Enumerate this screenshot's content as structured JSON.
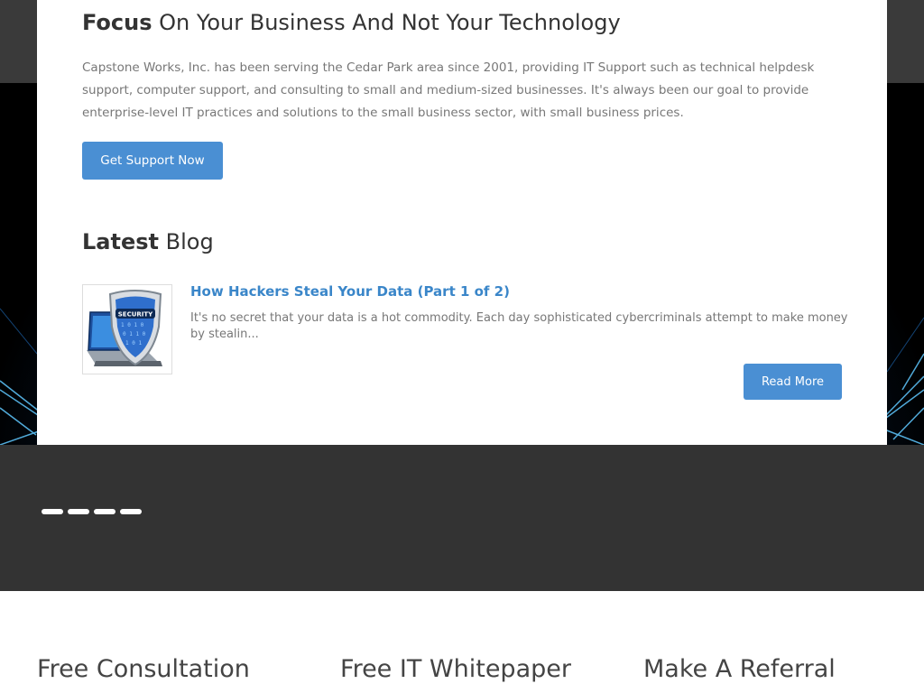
{
  "focus": {
    "title_bold": "Focus",
    "title_rest": "On Your Business And Not Your Technology",
    "intro": "Capstone Works, Inc. has been serving the Cedar Park area since 2001, providing IT Support such as technical helpdesk support, computer support, and consulting to small and medium-sized businesses. It's always been our goal to provide enterprise-level IT practices and solutions to the small business sector, with small business prices.",
    "button_label": "Get Support Now"
  },
  "latest": {
    "title_bold": "Latest",
    "title_rest": "Blog",
    "post": {
      "title": "How Hackers Steal Your Data (Part 1 of 2)",
      "excerpt": "It's no secret that your data is a hot commodity. Each day sophisticated cybercriminals attempt to make money by stealin...",
      "read_more_label": "Read More",
      "thumbnail_icon": "security-shield-laptop-icon",
      "thumbnail_text": "SECURITY"
    }
  },
  "slider": {
    "dot_count": 4
  },
  "bottom": {
    "headings": [
      "Free Consultation",
      "Free IT Whitepaper",
      "Make A Referral"
    ]
  },
  "colors": {
    "accent": "#4a8fd3",
    "link": "#3a86c9",
    "dark_band": "#333333"
  }
}
